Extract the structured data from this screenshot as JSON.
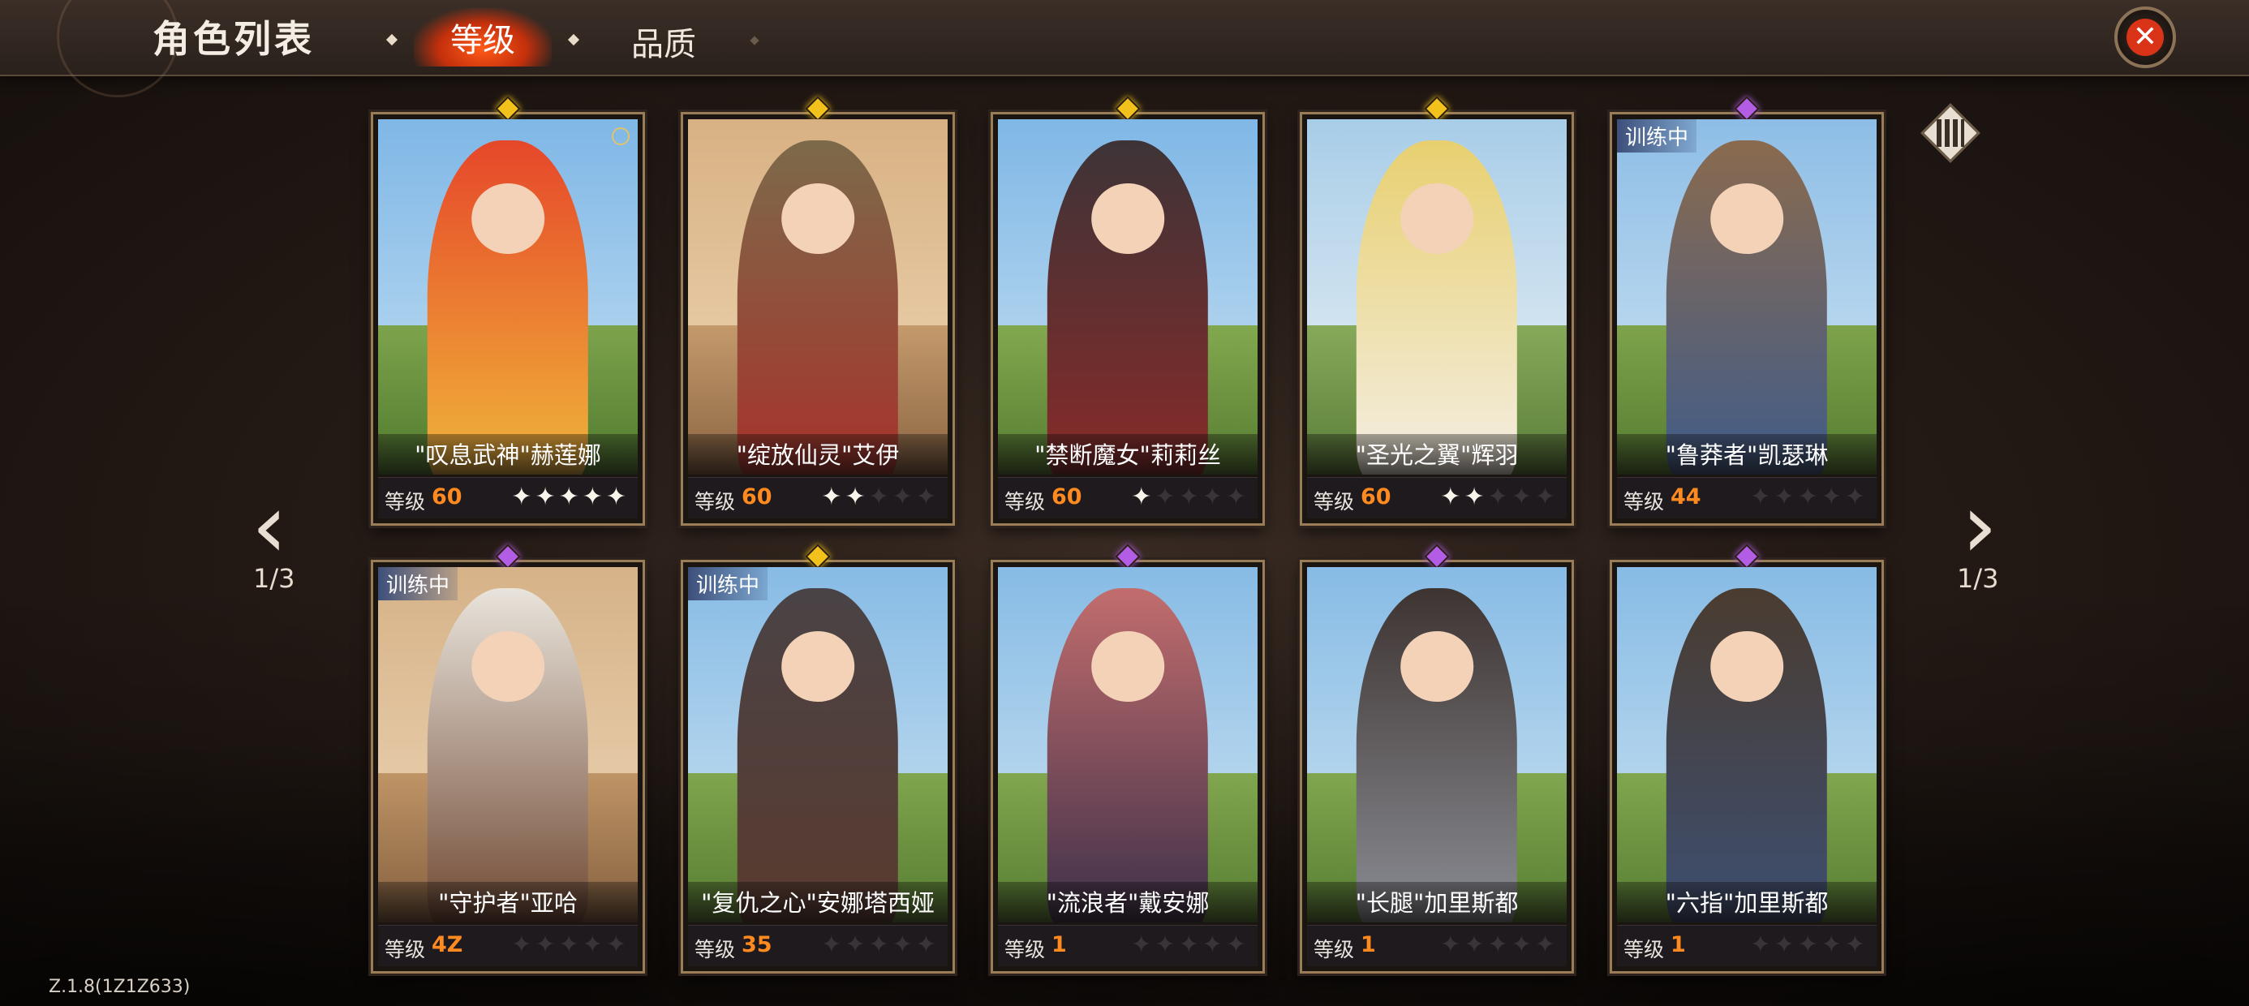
{
  "header": {
    "title": "角色列表",
    "tabs": [
      {
        "label": "等级",
        "active": true
      },
      {
        "label": "品质",
        "active": false
      }
    ]
  },
  "pager": {
    "left": "1/3",
    "right": "1/3"
  },
  "level_label": "等级",
  "version": "Z.1.8(1Z1Z633)",
  "colors": {
    "level_value": "#ff8a1f",
    "active_tab": "#d63a10",
    "gem_gold": "#f2c11b",
    "gem_purple": "#b35ce6",
    "close_button": "#d93417"
  },
  "characters": [
    {
      "name": "\"叹息武神\"赫莲娜",
      "level": "60",
      "stars": 5,
      "gem": "gold",
      "status": ""
    },
    {
      "name": "\"绽放仙灵\"艾伊",
      "level": "60",
      "stars": 2,
      "gem": "gold",
      "status": ""
    },
    {
      "name": "\"禁断魔女\"莉莉丝",
      "level": "60",
      "stars": 1,
      "gem": "gold",
      "status": ""
    },
    {
      "name": "\"圣光之翼\"辉羽",
      "level": "60",
      "stars": 2,
      "gem": "gold",
      "status": ""
    },
    {
      "name": "\"鲁莽者\"凯瑟琳",
      "level": "44",
      "stars": 0,
      "gem": "purple",
      "status": "训练中"
    },
    {
      "name": "\"守护者\"亚哈",
      "level": "4Z",
      "stars": 0,
      "gem": "purple",
      "status": "训练中"
    },
    {
      "name": "\"复仇之心\"安娜塔西娅",
      "level": "35",
      "stars": 0,
      "gem": "gold",
      "status": "训练中"
    },
    {
      "name": "\"流浪者\"戴安娜",
      "level": "1",
      "stars": 0,
      "gem": "purple",
      "status": ""
    },
    {
      "name": "\"长腿\"加里斯都",
      "level": "1",
      "stars": 0,
      "gem": "purple",
      "status": ""
    },
    {
      "name": "\"六指\"加里斯都",
      "level": "1",
      "stars": 0,
      "gem": "purple",
      "status": ""
    }
  ]
}
